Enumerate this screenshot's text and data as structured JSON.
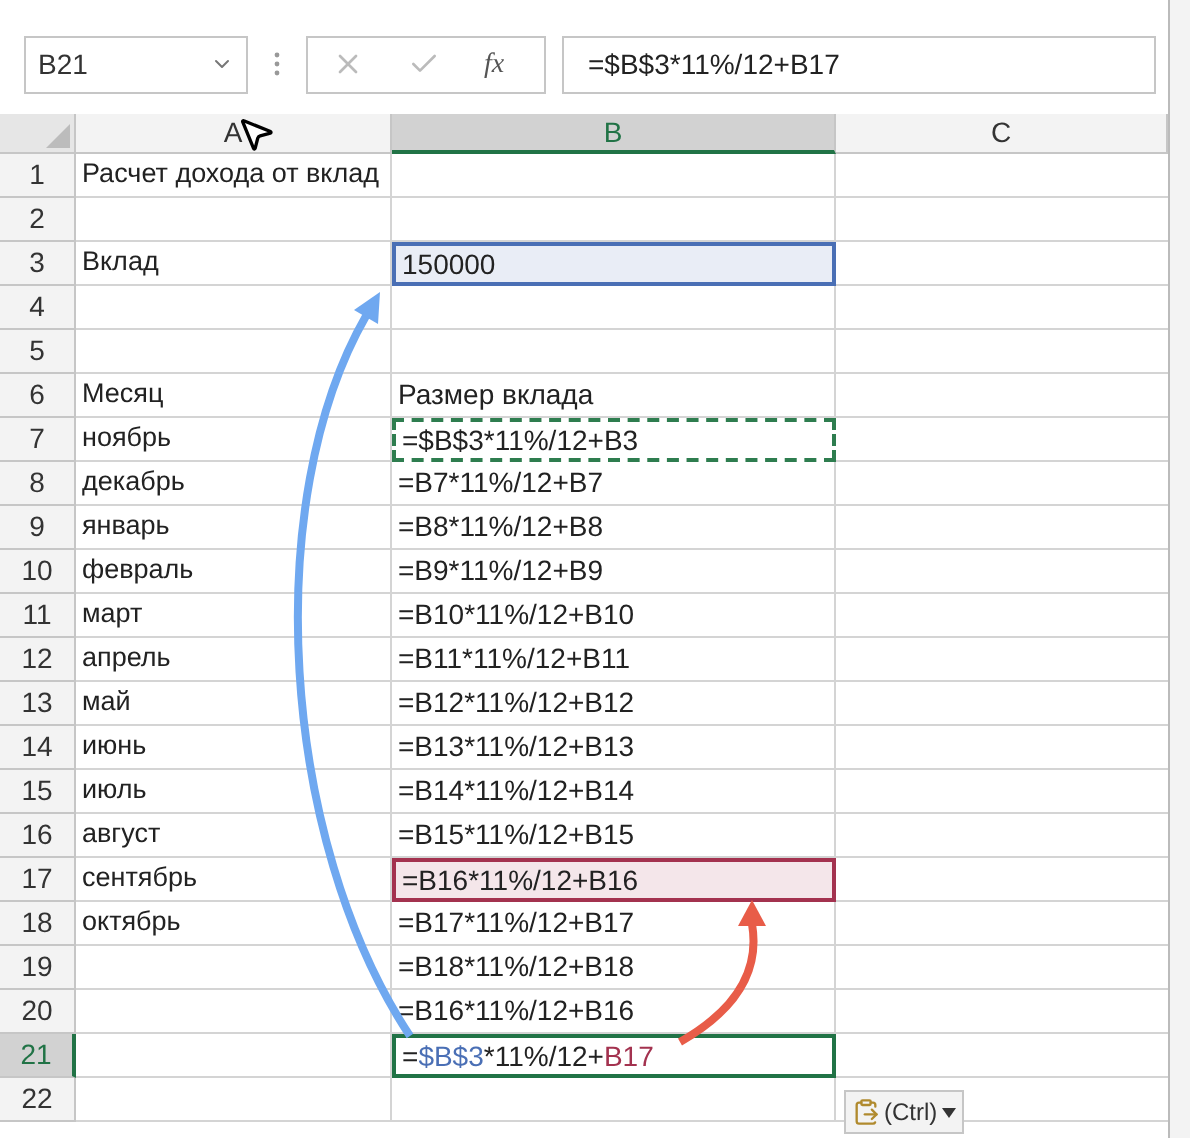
{
  "name_box": "B21",
  "formula_bar": {
    "function_label": "fx",
    "value": "=$B$3*11%/12+B17"
  },
  "columns": [
    {
      "label": "A",
      "selected": false
    },
    {
      "label": "B",
      "selected": true
    },
    {
      "label": "C",
      "selected": false
    }
  ],
  "rows": [
    {
      "number": "1",
      "selected": false,
      "col_a": "Расчет дохода от вклад"
    },
    {
      "number": "2",
      "selected": false
    },
    {
      "number": "3",
      "selected": false,
      "col_a": "Вклад",
      "col_b": {
        "text": "150000",
        "kind": "reference",
        "color": "#4a6fb5"
      }
    },
    {
      "number": "4",
      "selected": false
    },
    {
      "number": "5",
      "selected": false
    },
    {
      "number": "6",
      "selected": false,
      "col_a": "Месяц",
      "col_b": {
        "text": "Размер вклада",
        "kind": "plain"
      }
    },
    {
      "number": "7",
      "selected": false,
      "col_a": "ноябрь",
      "col_b": {
        "text": "=$B$3*11%/12+B3",
        "kind": "copy",
        "color": "#2e7d4f"
      }
    },
    {
      "number": "8",
      "selected": false,
      "col_a": "декабрь",
      "col_b": {
        "text": "=B7*11%/12+B7",
        "kind": "plain"
      }
    },
    {
      "number": "9",
      "selected": false,
      "col_a": "январь",
      "col_b": {
        "text": "=B8*11%/12+B8",
        "kind": "plain"
      }
    },
    {
      "number": "10",
      "selected": false,
      "col_a": "февраль",
      "col_b": {
        "text": "=B9*11%/12+B9",
        "kind": "plain"
      }
    },
    {
      "number": "11",
      "selected": false,
      "col_a": "март",
      "col_b": {
        "text": "=B10*11%/12+B10",
        "kind": "plain"
      }
    },
    {
      "number": "12",
      "selected": false,
      "col_a": "апрель",
      "col_b": {
        "text": "=B11*11%/12+B11",
        "kind": "plain"
      }
    },
    {
      "number": "13",
      "selected": false,
      "col_a": "май",
      "col_b": {
        "text": "=B12*11%/12+B12",
        "kind": "plain"
      }
    },
    {
      "number": "14",
      "selected": false,
      "col_a": "июнь",
      "col_b": {
        "text": "=B13*11%/12+B13",
        "kind": "plain"
      }
    },
    {
      "number": "15",
      "selected": false,
      "col_a": "июль",
      "col_b": {
        "text": "=B14*11%/12+B14",
        "kind": "plain"
      }
    },
    {
      "number": "16",
      "selected": false,
      "col_a": "август",
      "col_b": {
        "text": "=B15*11%/12+B15",
        "kind": "plain"
      }
    },
    {
      "number": "17",
      "selected": false,
      "col_a": "сентябрь",
      "col_b": {
        "text": "=B16*11%/12+B16",
        "kind": "reference",
        "color": "#a3324f"
      }
    },
    {
      "number": "18",
      "selected": false,
      "col_a": "октябрь",
      "col_b": {
        "text": "=B17*11%/12+B17",
        "kind": "plain"
      }
    },
    {
      "number": "19",
      "selected": false,
      "col_b": {
        "text": "=B18*11%/12+B18",
        "kind": "plain"
      }
    },
    {
      "number": "20",
      "selected": false,
      "col_b": {
        "text": "=B16*11%/12+B16",
        "kind": "plain"
      }
    },
    {
      "number": "21",
      "selected": true,
      "col_b": {
        "kind": "active",
        "color": "#217346",
        "segments": [
          {
            "text": "=",
            "color": "#222222"
          },
          {
            "text": "$B$3",
            "color": "#4a6fb5"
          },
          {
            "text": "*11%/12+",
            "color": "#222222"
          },
          {
            "text": "B17",
            "color": "#a3324f"
          }
        ]
      }
    },
    {
      "number": "22",
      "selected": false
    }
  ],
  "paste_options": {
    "label": "(Ctrl)"
  }
}
